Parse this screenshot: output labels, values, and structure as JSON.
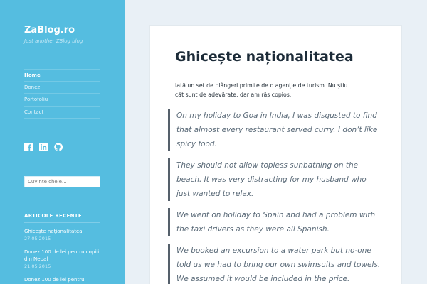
{
  "site": {
    "title": "ZaBlog.ro",
    "tagline": "Just another ZBlog blog"
  },
  "nav": [
    {
      "label": "Home",
      "active": true
    },
    {
      "label": "Donez",
      "active": false
    },
    {
      "label": "Portofoliu",
      "active": false
    },
    {
      "label": "Contact",
      "active": false
    }
  ],
  "social": [
    "facebook-icon",
    "linkedin-icon",
    "github-icon"
  ],
  "search": {
    "placeholder": "Cuvinte cheie..."
  },
  "recent": {
    "heading": "ARTICOLE RECENTE",
    "items": [
      {
        "title": "Ghicește naționalitatea",
        "date": "27.05.2015"
      },
      {
        "title": "Donez 100 de lei pentru copiii din Nepal",
        "date": "21.05.2015"
      },
      {
        "title": "Donez 100 de lei pentru",
        "date": ""
      }
    ]
  },
  "post": {
    "title": "Ghicește naționalitatea",
    "intro": "Iată un set de plângeri primite de o agenție de turism. Nu știu cât sunt de adevărate, dar am râs copios.",
    "quotes": [
      "On my holiday to Goa in India, I was disgusted to find that almost every restaurant served curry. I don’t like spicy food.",
      "They should not allow topless sunbathing on the beach. It was very distracting for my husband who just wanted to relax.",
      "We went on holiday to Spain and had a problem with the taxi drivers as they were all Spanish.",
      "We booked an excursion to a water park but no-one told us we had to bring our own swimsuits and towels. We assumed it would be included in the price."
    ]
  },
  "colors": {
    "sidebar": "#55bde0",
    "background": "#e9f0f6",
    "quote_border": "#55606b"
  }
}
